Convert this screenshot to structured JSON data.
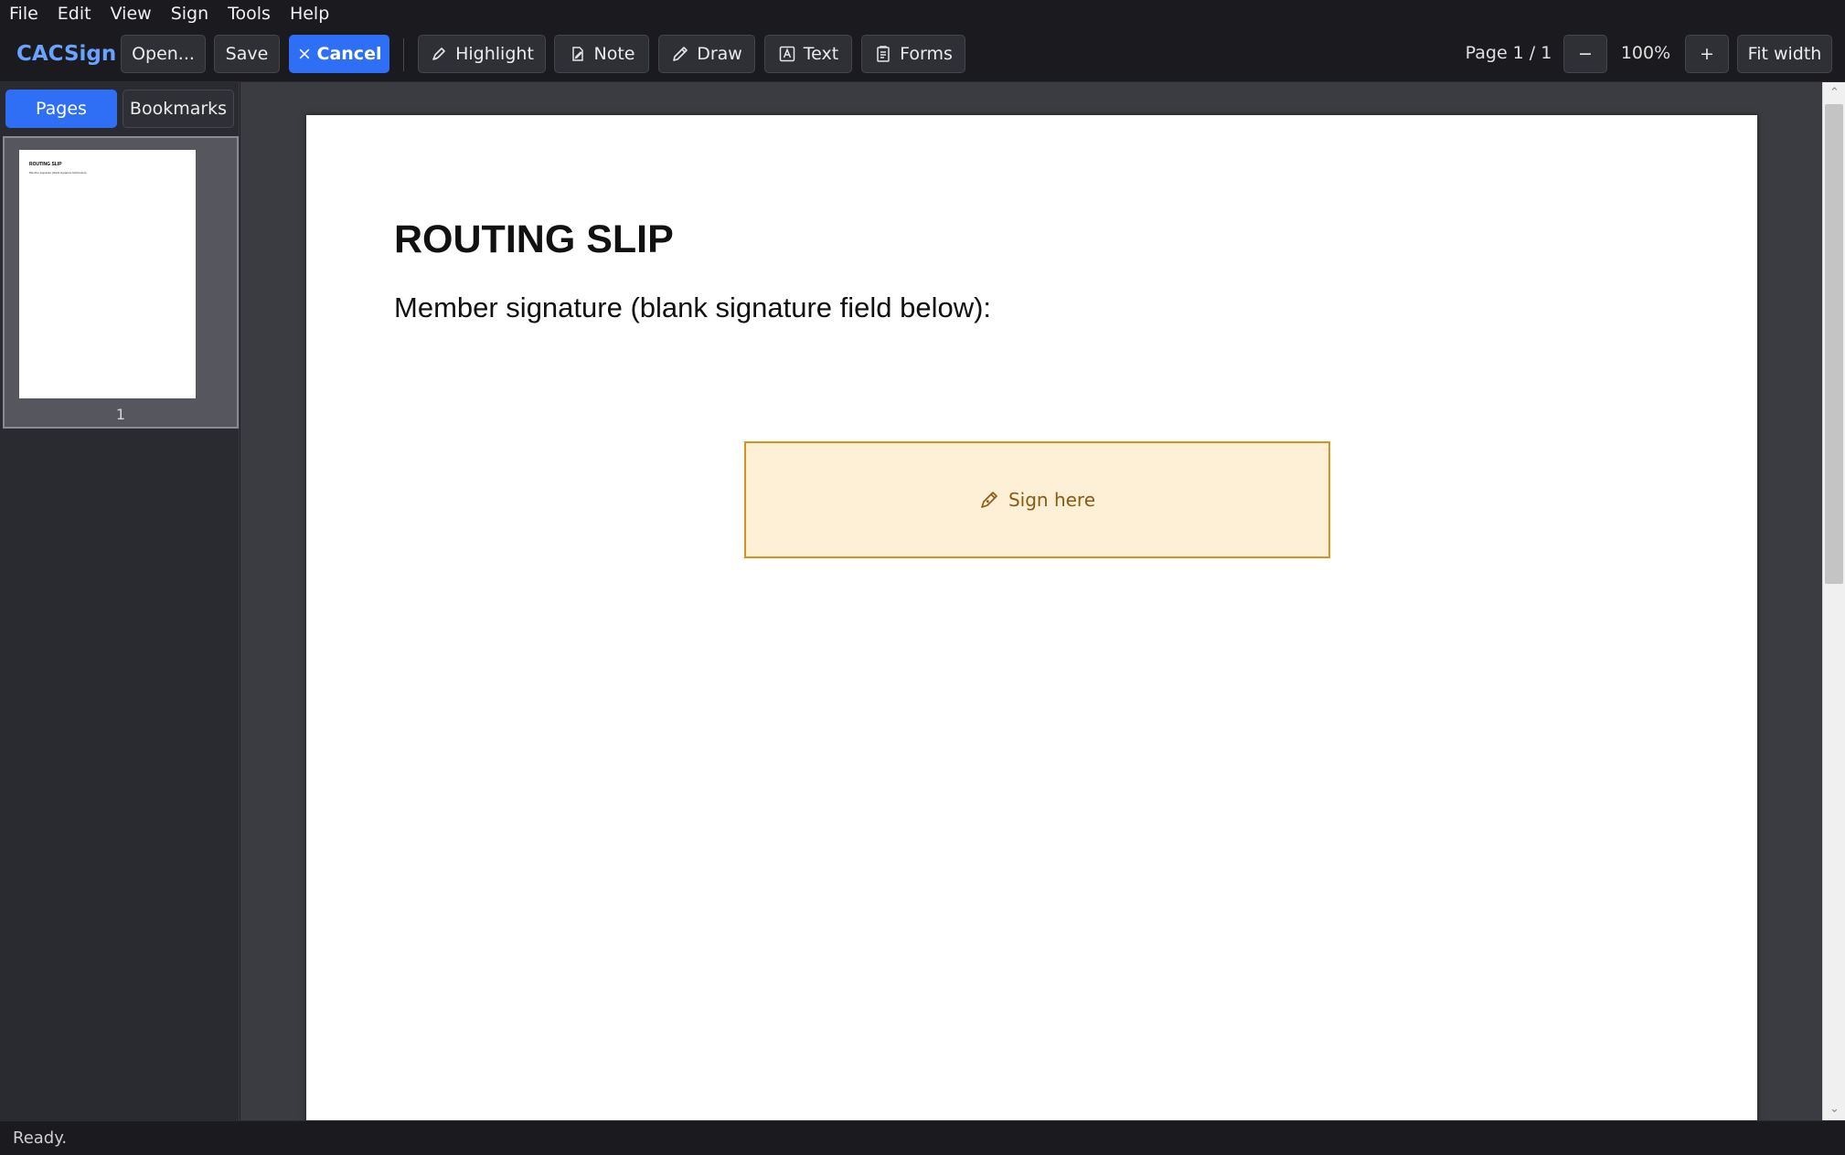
{
  "menu": [
    "File",
    "Edit",
    "View",
    "Sign",
    "Tools",
    "Help"
  ],
  "app": {
    "name": "CACSign"
  },
  "toolbar": {
    "open_label": "Open...",
    "save_label": "Save",
    "cancel_label": "Cancel",
    "highlight_label": "Highlight",
    "note_label": "Note",
    "draw_label": "Draw",
    "text_label": "Text",
    "forms_label": "Forms",
    "page_indicator": "Page 1 / 1",
    "zoom_out_label": "−",
    "zoom_level": "100%",
    "zoom_in_label": "+",
    "fit_width_label": "Fit width"
  },
  "sidebar": {
    "tabs": [
      {
        "label": "Pages",
        "active": true
      },
      {
        "label": "Bookmarks",
        "active": false
      }
    ],
    "thumbnails": [
      {
        "page_number": "1",
        "title": "ROUTING SLIP",
        "subtitle": "Member signature (blank signature field below):"
      }
    ]
  },
  "document": {
    "title": "ROUTING SLIP",
    "subtitle": "Member signature (blank signature field below):",
    "signature_field_label": "Sign here"
  },
  "status": {
    "text": "Ready."
  },
  "colors": {
    "accent": "#2f6ff5",
    "brand": "#6aa2ff",
    "signature_fill": "#fdf0d6",
    "signature_border": "#d9921e"
  },
  "icons": {
    "cancel": "close-icon",
    "highlight": "highlighter-icon",
    "note": "note-icon",
    "draw": "pencil-icon",
    "text": "text-box-icon",
    "forms": "form-icon",
    "signature": "pen-nib-icon"
  }
}
